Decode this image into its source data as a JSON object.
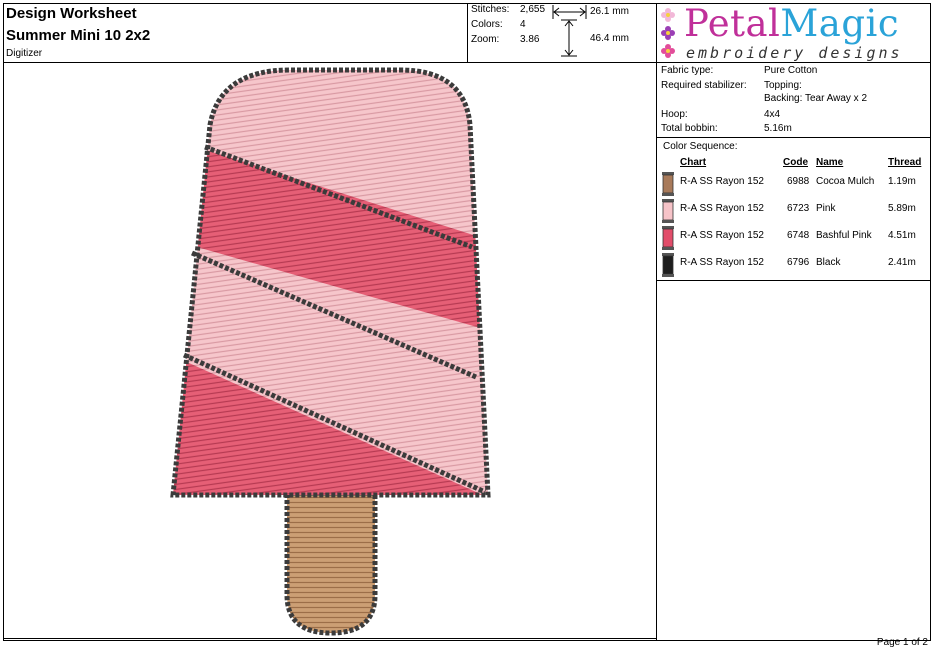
{
  "header": {
    "title": "Design Worksheet",
    "design_name": "Summer Mini 10 2x2",
    "subtitle": "Digitizer"
  },
  "stats": {
    "stitches_label": "Stitches:",
    "stitches_value": "2,655",
    "colors_label": "Colors:",
    "colors_value": "4",
    "zoom_label": "Zoom:",
    "zoom_value": "3.86",
    "width": "26.1 mm",
    "height": "46.4 mm"
  },
  "logo": {
    "brand_part1": "Petal",
    "brand_part2": "Magic",
    "tagline": "embroidery designs",
    "colors": {
      "petal": "#c0309a",
      "magic": "#2aa3d8"
    }
  },
  "info": {
    "fabric_label": "Fabric type:",
    "fabric_value": "Pure Cotton",
    "stabilizer_label": "Required stabilizer:",
    "topping": "Topping:",
    "backing": "Backing: Tear Away x 2",
    "hoop_label": "Hoop:",
    "hoop_value": "4x4",
    "bobbin_label": "Total bobbin:",
    "bobbin_value": "5.16m"
  },
  "color_sequence": {
    "title": "Color Sequence:",
    "headers": {
      "chart": "Chart",
      "code": "Code",
      "name": "Name",
      "thread": "Thread"
    },
    "rows": [
      {
        "chart": "R-A SS Rayon 152",
        "code": "6988",
        "name": "Cocoa Mulch",
        "thread": "1.19m",
        "color": "#a87a5a"
      },
      {
        "chart": "R-A SS Rayon 152",
        "code": "6723",
        "name": "Pink",
        "thread": "5.89m",
        "color": "#f6c3c8"
      },
      {
        "chart": "R-A SS Rayon 152",
        "code": "6748",
        "name": "Bashful Pink",
        "thread": "4.51m",
        "color": "#e24d6a"
      },
      {
        "chart": "R-A SS Rayon 152",
        "code": "6796",
        "name": "Black",
        "thread": "2.41m",
        "color": "#1e1e1e"
      }
    ]
  },
  "design": {
    "icons": [
      "popsicle-embroidery"
    ],
    "colors": {
      "light_pink": "#f6c3c8",
      "dark_pink": "#e0576e",
      "stick": "#c99a6e",
      "outline": "#3b3b3b"
    }
  },
  "footer": {
    "page": "Page 1 of 2"
  }
}
